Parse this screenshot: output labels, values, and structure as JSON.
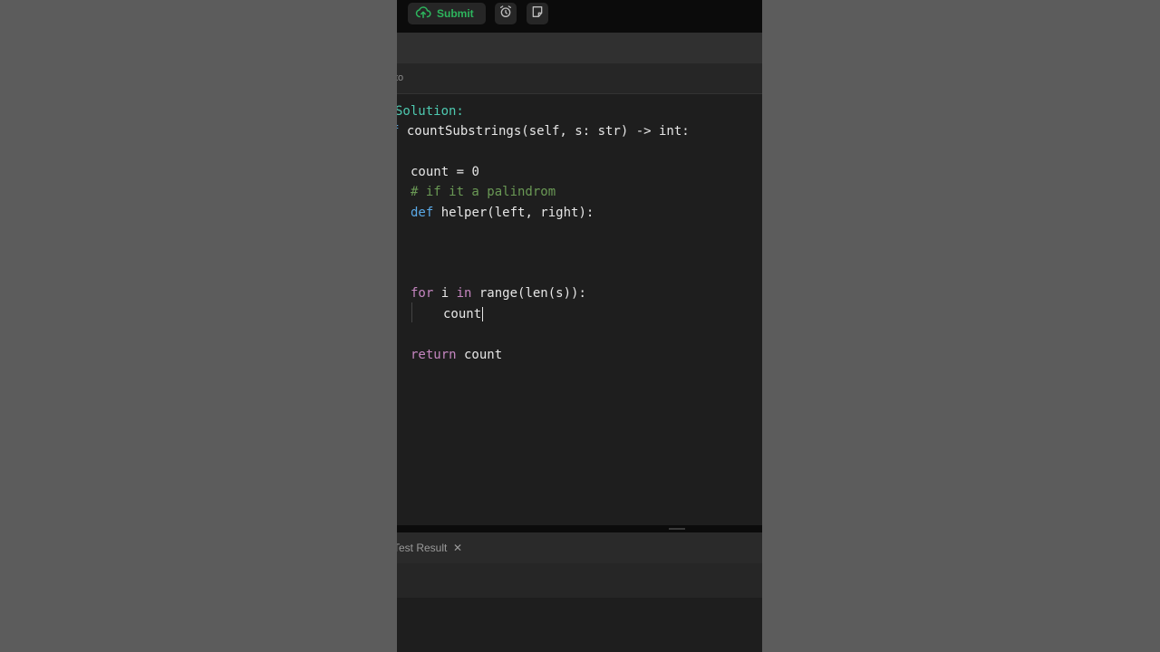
{
  "toolbar": {
    "submit_label": "Submit",
    "submit_icon": "cloud-upload-icon",
    "alarm_icon": "alarm-clock-icon",
    "notes_icon": "note-icon",
    "accent_color": "#2db55d"
  },
  "editor": {
    "language_label": "to",
    "lines": {
      "l1": "Solution:",
      "l2a": "f ",
      "l2b": "countSubstrings(self, s: str) -> int:",
      "l3a": "count",
      "l3b": " = 0",
      "l4": "# if it a palindrom",
      "l5a": "def",
      "l5b": " helper(left, right):",
      "l6a": "for",
      "l6b": " i ",
      "l6c": "in",
      "l6d": " range(len(s)):",
      "l7": "count",
      "l8a": "return",
      "l8b": " count"
    }
  },
  "bottom_panel": {
    "tab_label": "Test Result",
    "close_symbol": "✕"
  }
}
